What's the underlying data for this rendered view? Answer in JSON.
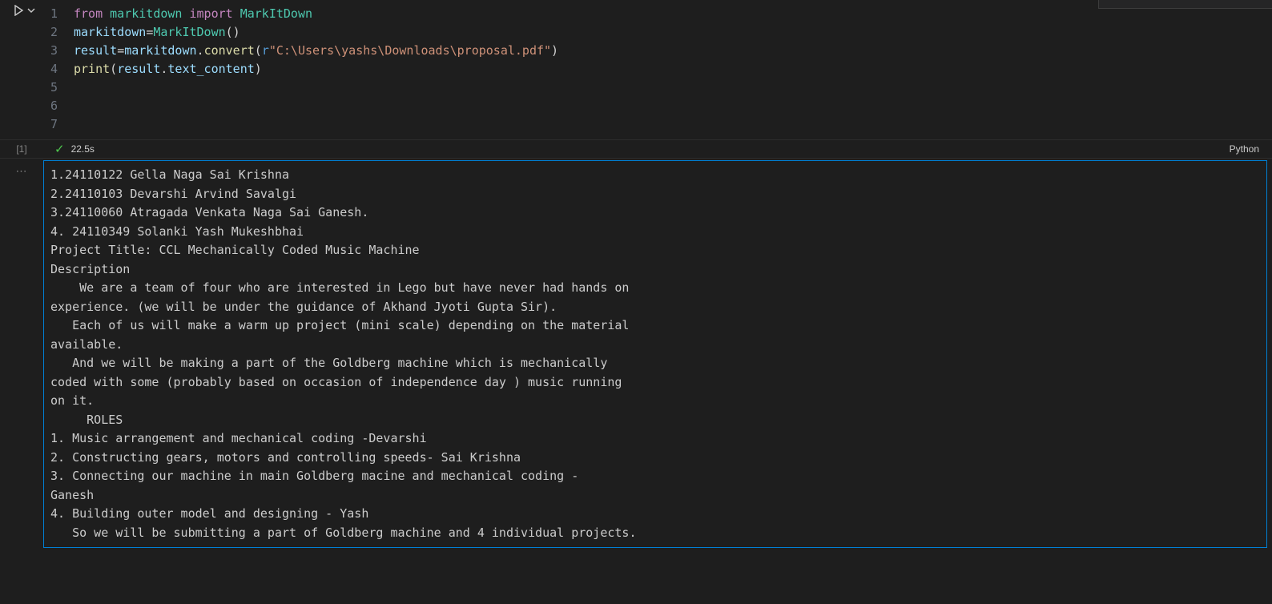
{
  "editor": {
    "lines": [
      1,
      2,
      3,
      4,
      5,
      6,
      7
    ],
    "code": {
      "l1_from": "from",
      "l1_mod": "markitdown",
      "l1_import": "import",
      "l1_cls": "MarkItDown",
      "l2_var": "markitdown",
      "l2_eq": "=",
      "l2_cls": "MarkItDown",
      "l2_paren": "()",
      "l3_var": "result",
      "l3_eq": "=",
      "l3_obj": "markitdown",
      "l3_dot": ".",
      "l3_fn": "convert",
      "l3_open": "(",
      "l3_pfx": "r",
      "l3_str": "\"C:\\Users\\yashs\\Downloads\\proposal.pdf\"",
      "l3_close": ")",
      "l4_fn": "print",
      "l4_open": "(",
      "l4_obj": "result",
      "l4_dot": ".",
      "l4_attr": "text_content",
      "l4_close": ")"
    }
  },
  "status": {
    "exec_count": "[1]",
    "timing": "22.5s",
    "language": "Python"
  },
  "output_lines": [
    "1.24110122 Gella Naga Sai Krishna",
    "2.24110103 Devarshi Arvind Savalgi",
    "3.24110060 Atragada Venkata Naga Sai Ganesh.",
    "4. 24110349 Solanki Yash Mukeshbhai",
    "Project Title: CCL Mechanically Coded Music Machine",
    "Description",
    "    We are a team of four who are interested in Lego but have never had hands on ",
    "experience. (we will be under the guidance of Akhand Jyoti Gupta Sir).",
    "   Each of us will make a warm up project (mini scale) depending on the material ",
    "available.",
    "   And we will be making a part of the Goldberg machine which is mechanically ",
    "coded with some (probably based on occasion of independence day ) music running ",
    "on it.",
    "     ROLES",
    "1. Music arrangement and mechanical coding -Devarshi",
    "2. Constructing gears, motors and controlling speeds- Sai Krishna",
    "3. Connecting our machine in main Goldberg macine and mechanical coding -",
    "Ganesh",
    "4. Building outer model and designing - Yash",
    "   So we will be submitting a part of Goldberg machine and 4 individual projects."
  ],
  "icons": {
    "run": "run-cell-icon",
    "chevron": "chevron-down-icon",
    "success": "check-icon",
    "more": "ellipsis-icon"
  }
}
